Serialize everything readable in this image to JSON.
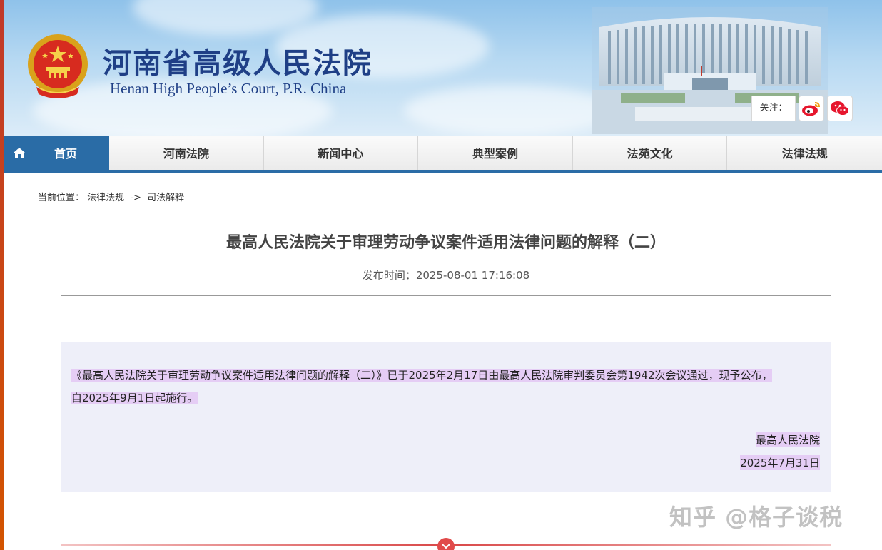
{
  "header": {
    "title_cn": "河南省高级人民法院",
    "title_en": "Henan High People’s Court, P.R. China",
    "follow_label": "关注：",
    "social_icons": [
      "weibo-icon",
      "wechat-icon"
    ]
  },
  "nav": {
    "home": "首页",
    "items": [
      "河南法院",
      "新闻中心",
      "典型案例",
      "法苑文化",
      "法律法规"
    ]
  },
  "breadcrumb": {
    "prefix": "当前位置：",
    "level1": "法律法规",
    "separator": "->",
    "level2": "司法解释"
  },
  "article": {
    "title": "最高人民法院关于审理劳动争议案件适用法律问题的解释（二）",
    "publish_time": "发布时间：2025-08-01 17:16:08",
    "para_line1": "《最高人民法院关于审理劳动争议案件适用法律问题的解释（二）》已于2025年2月17日由最高人民法院审判委员会第1942次会议通过，现予公布，",
    "para_line2": "自2025年9月1日起施行。",
    "signature_org": "最高人民法院",
    "signature_date": "2025年7月31日"
  },
  "watermark": "知乎 @格子谈税",
  "colors": {
    "nav_blue": "#2a6ca6",
    "title_blue": "#1f3f86",
    "highlight": "#e5cdf5",
    "content_bg": "#eeeff9",
    "footer_red": "#e14b4b"
  }
}
